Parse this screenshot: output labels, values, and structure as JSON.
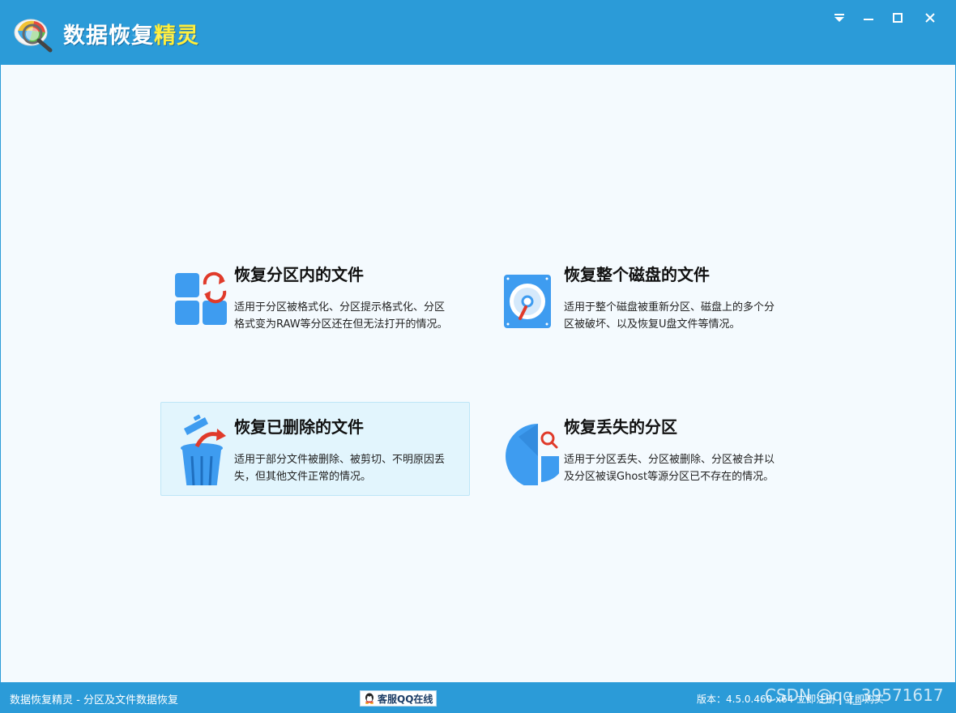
{
  "window": {
    "title_main": "数据恢复",
    "title_accent": "精灵",
    "controls": [
      "menu",
      "minimize",
      "maximize",
      "close"
    ]
  },
  "options": [
    {
      "title": "恢复分区内的文件",
      "desc_line1": "适用于分区被格式化、分区提示格式化、分区",
      "desc_line2": "格式变为RAW等分区还在但无法打开的情况。",
      "icon": "partition-files-icon"
    },
    {
      "title": "恢复整个磁盘的文件",
      "desc_line1": "适用于整个磁盘被重新分区、磁盘上的多个分",
      "desc_line2": "区被破坏、以及恢复U盘文件等情况。",
      "icon": "disk-icon"
    },
    {
      "title": "恢复已删除的文件",
      "desc_line1": "适用于部分文件被删除、被剪切、不明原因丢",
      "desc_line2": "失，但其他文件正常的情况。",
      "icon": "trash-restore-icon",
      "active": true
    },
    {
      "title": "恢复丢失的分区",
      "desc_line1": "适用于分区丢失、分区被删除、分区被合并以",
      "desc_line2": "及分区被误Ghost等源分区已不存在的情况。",
      "icon": "pie-search-icon"
    }
  ],
  "statusbar": {
    "left_text": "数据恢复精灵 - 分区及文件数据恢复",
    "qq_label": "客服QQ在线",
    "version_text": "版本：4.5.0.460 x64  立即注册  |  立即购买"
  },
  "watermark": "CSDN @qq_39571617",
  "colors": {
    "titlebar": "#2b9bd8",
    "content_bg": "#f4fafe",
    "active_card_bg": "#e2f5fd",
    "icon_blue": "#3e9cf0",
    "icon_red": "#e03a2a"
  }
}
